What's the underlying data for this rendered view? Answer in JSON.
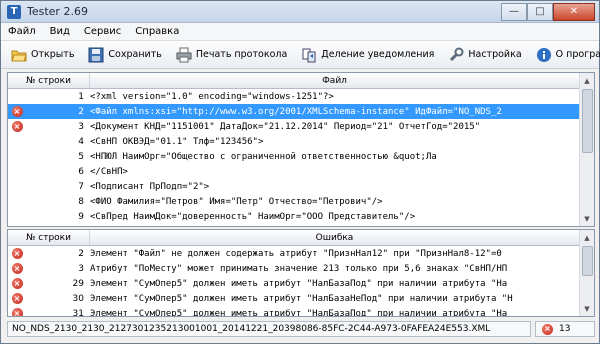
{
  "window": {
    "title": "Tester 2.69",
    "app_icon_letter": "T"
  },
  "menu": [
    "Файл",
    "Вид",
    "Сервис",
    "Справка"
  ],
  "toolbar": {
    "open": "Открыть",
    "save": "Сохранить",
    "print": "Печать протокола",
    "split": "Деление уведомления",
    "settings": "Настройка",
    "about": "О программе"
  },
  "file_grid": {
    "col_num": "№ строки",
    "col_text": "Файл",
    "rows": [
      {
        "n": "1",
        "text": "<?xml version=\"1.0\" encoding=\"windows-1251\"?>",
        "err": false,
        "sel": false
      },
      {
        "n": "2",
        "text": "<Файл xmlns:xsi=\"http://www.w3.org/2001/XMLSchema-instance\" ИдФайл=\"NO_NDS_2",
        "err": true,
        "sel": true
      },
      {
        "n": "3",
        "text": "    <Документ КНД=\"1151001\" ДатаДок=\"21.12.2014\" Период=\"21\" ОтчетГод=\"2015\"",
        "err": true,
        "sel": false
      },
      {
        "n": "4",
        "text": "        <СвНП ОКВЭД=\"01.1\" Тлф=\"123456\">",
        "err": false,
        "sel": false
      },
      {
        "n": "5",
        "text": "            <НПЮЛ НаимОрг=\"Общество с ограниченной ответственностью &quot;Ла",
        "err": false,
        "sel": false
      },
      {
        "n": "6",
        "text": "        </СвНП>",
        "err": false,
        "sel": false
      },
      {
        "n": "7",
        "text": "        <Подписант ПрПодп=\"2\">",
        "err": false,
        "sel": false
      },
      {
        "n": "8",
        "text": "            <ФИО Фамилия=\"Петров\" Имя=\"Петр\" Отчество=\"Петрович\"/>",
        "err": false,
        "sel": false
      },
      {
        "n": "9",
        "text": "            <СвПред НаимДок=\"доверенность\" НаимОрг=\"ООО Представитель\"/>",
        "err": false,
        "sel": false
      }
    ]
  },
  "error_grid": {
    "col_num": "№ строки",
    "col_text": "Ошибка",
    "rows": [
      {
        "n": "2",
        "text": "Элемент \"Файл\" не должен содержать атрибут \"ПризнНал12\" при \"ПризнНал8-12\"=0"
      },
      {
        "n": "3",
        "text": "Атрибут \"ПоМесту\" может принимать значение 213 только при 5,6 знаках \"СвНП/НП"
      },
      {
        "n": "29",
        "text": "Элемент \"СумОпер5\" должен иметь атрибут \"НалБазаПод\" при наличии атрибута \"На"
      },
      {
        "n": "30",
        "text": "Элемент \"СумОпер5\" должен иметь атрибут \"НалБазаНеПод\" при наличии атрибута \"Н"
      },
      {
        "n": "31",
        "text": "Элемент \"СумОпер5\" должен иметь атрибут \"НалБазаПод\" при наличии атрибута \"На"
      }
    ]
  },
  "status": {
    "path": "NO_NDS_2130_2130_2127301235213001001_20141221_20398086-85FC-2C44-A973-0FAFEA24E553.XML",
    "error_count": "13"
  }
}
